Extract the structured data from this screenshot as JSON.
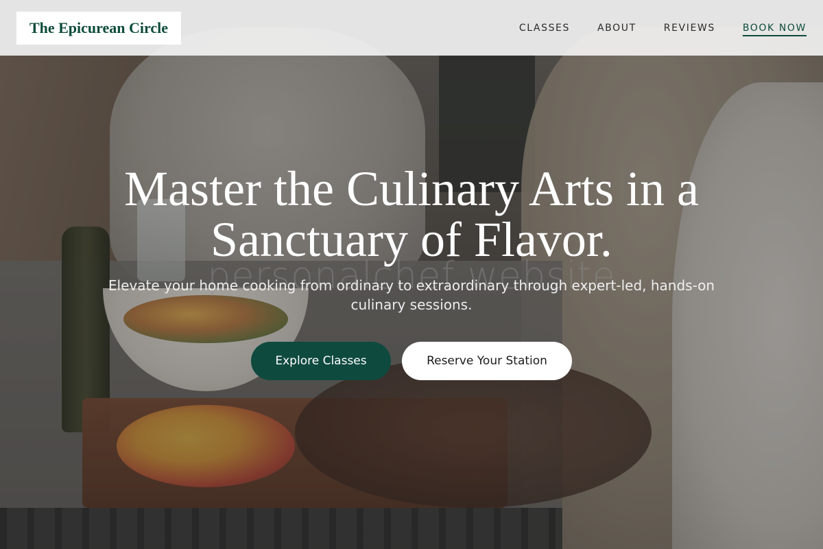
{
  "site": {
    "brand": "The Epicurean Circle"
  },
  "nav": {
    "items": [
      {
        "label": "CLASSES"
      },
      {
        "label": "ABOUT"
      },
      {
        "label": "REVIEWS"
      },
      {
        "label": "BOOK NOW"
      }
    ]
  },
  "hero": {
    "title_line1": "Master the Culinary Arts in a",
    "title_line2": "Sanctuary of Flavor.",
    "watermark": "personalchef website",
    "subtitle": "Elevate your home cooking from ordinary to extraordinary through expert-led, hands-on culinary sessions.",
    "primary_cta": "Explore Classes",
    "secondary_cta": "Reserve Your Station"
  },
  "colors": {
    "brand_green": "#0b4b3a",
    "primary_button": "#0f4a3f",
    "header_bg": "#f5f5f5"
  }
}
